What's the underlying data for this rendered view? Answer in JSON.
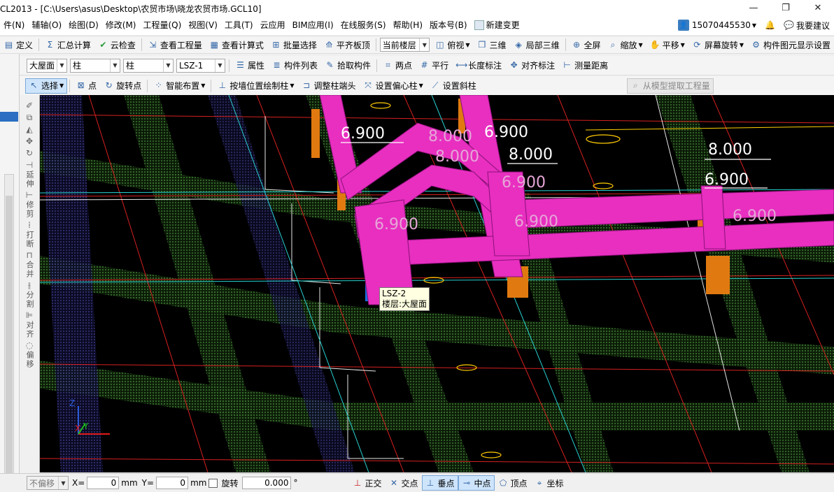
{
  "window": {
    "title": "CL2013 - [C:\\Users\\asus\\Desktop\\农贸市场\\晓龙农贸市场.GCL10]",
    "min_label": "—",
    "max_label": "❐",
    "close_label": "✕"
  },
  "menu": [
    "件(N)",
    "辅轴(O)",
    "绘图(D)",
    "修改(M)",
    "工程量(Q)",
    "视图(V)",
    "工具(T)",
    "云应用",
    "BIM应用(I)",
    "在线服务(S)",
    "帮助(H)",
    "版本号(B)",
    "新建变更"
  ],
  "user": {
    "account": "15070445530",
    "suggest": "我要建议"
  },
  "toolbar1": {
    "define": "定义",
    "summary": "汇总计算",
    "cloud_check": "云检查",
    "view_qty": "查看工程量",
    "view_formula": "查看计算式",
    "batch_select": "批量选择",
    "flush_slab": "平齐板顶",
    "floor_select": "当前楼层",
    "top_view": "俯视",
    "three_d": "三维",
    "local_3d": "局部三维",
    "fullscreen": "全屏",
    "zoom": "缩放",
    "pan": "平移",
    "rotate": "屏幕旋转",
    "display_settings": "构件图元显示设置"
  },
  "toolbar2": {
    "floor": "大屋面",
    "category": "柱",
    "type": "柱",
    "component": "LSZ-1",
    "props": "属性",
    "list": "构件列表",
    "pick": "拾取构件",
    "two_points": "两点",
    "parallel": "平行",
    "length_mark": "长度标注",
    "align_mark": "对齐标注",
    "measure": "测量距离"
  },
  "toolbar3": {
    "select": "选择",
    "point": "点",
    "rotate_point": "旋转点",
    "smart": "智能布置",
    "by_wall": "按墙位置绘制柱",
    "adjust_head": "调整柱端头",
    "offset": "设置偏心柱",
    "slope": "设置斜柱",
    "extract": "从模型提取工程量"
  },
  "side_tools": [
    "延伸",
    "修剪",
    "打断",
    "合并",
    "分割",
    "对齐",
    "偏移"
  ],
  "viewport": {
    "labels": [
      {
        "text": "6.900"
      },
      {
        "text": "8.000"
      },
      {
        "text": "6.900"
      },
      {
        "text": "8.000"
      },
      {
        "text": "8.000"
      },
      {
        "text": "6.900"
      },
      {
        "text": "6.900"
      },
      {
        "text": "6.900"
      },
      {
        "text": "6.900"
      },
      {
        "text": "6.900"
      }
    ],
    "tooltip_line1": "LSZ-2",
    "tooltip_line2": "楼层:大屋面",
    "axis_x": "X",
    "axis_y": "Y",
    "axis_z": "Z"
  },
  "status": {
    "offset_mode": "不偏移",
    "x_label": "X=",
    "x_value": "0",
    "mm1": "mm",
    "y_label": "Y=",
    "y_value": "0",
    "mm2": "mm",
    "rotate_label": "旋转",
    "rotate_value": "0.000",
    "degree": "°",
    "snap": [
      "正交",
      "交点",
      "垂点",
      "中点",
      "顶点",
      "坐标"
    ]
  }
}
